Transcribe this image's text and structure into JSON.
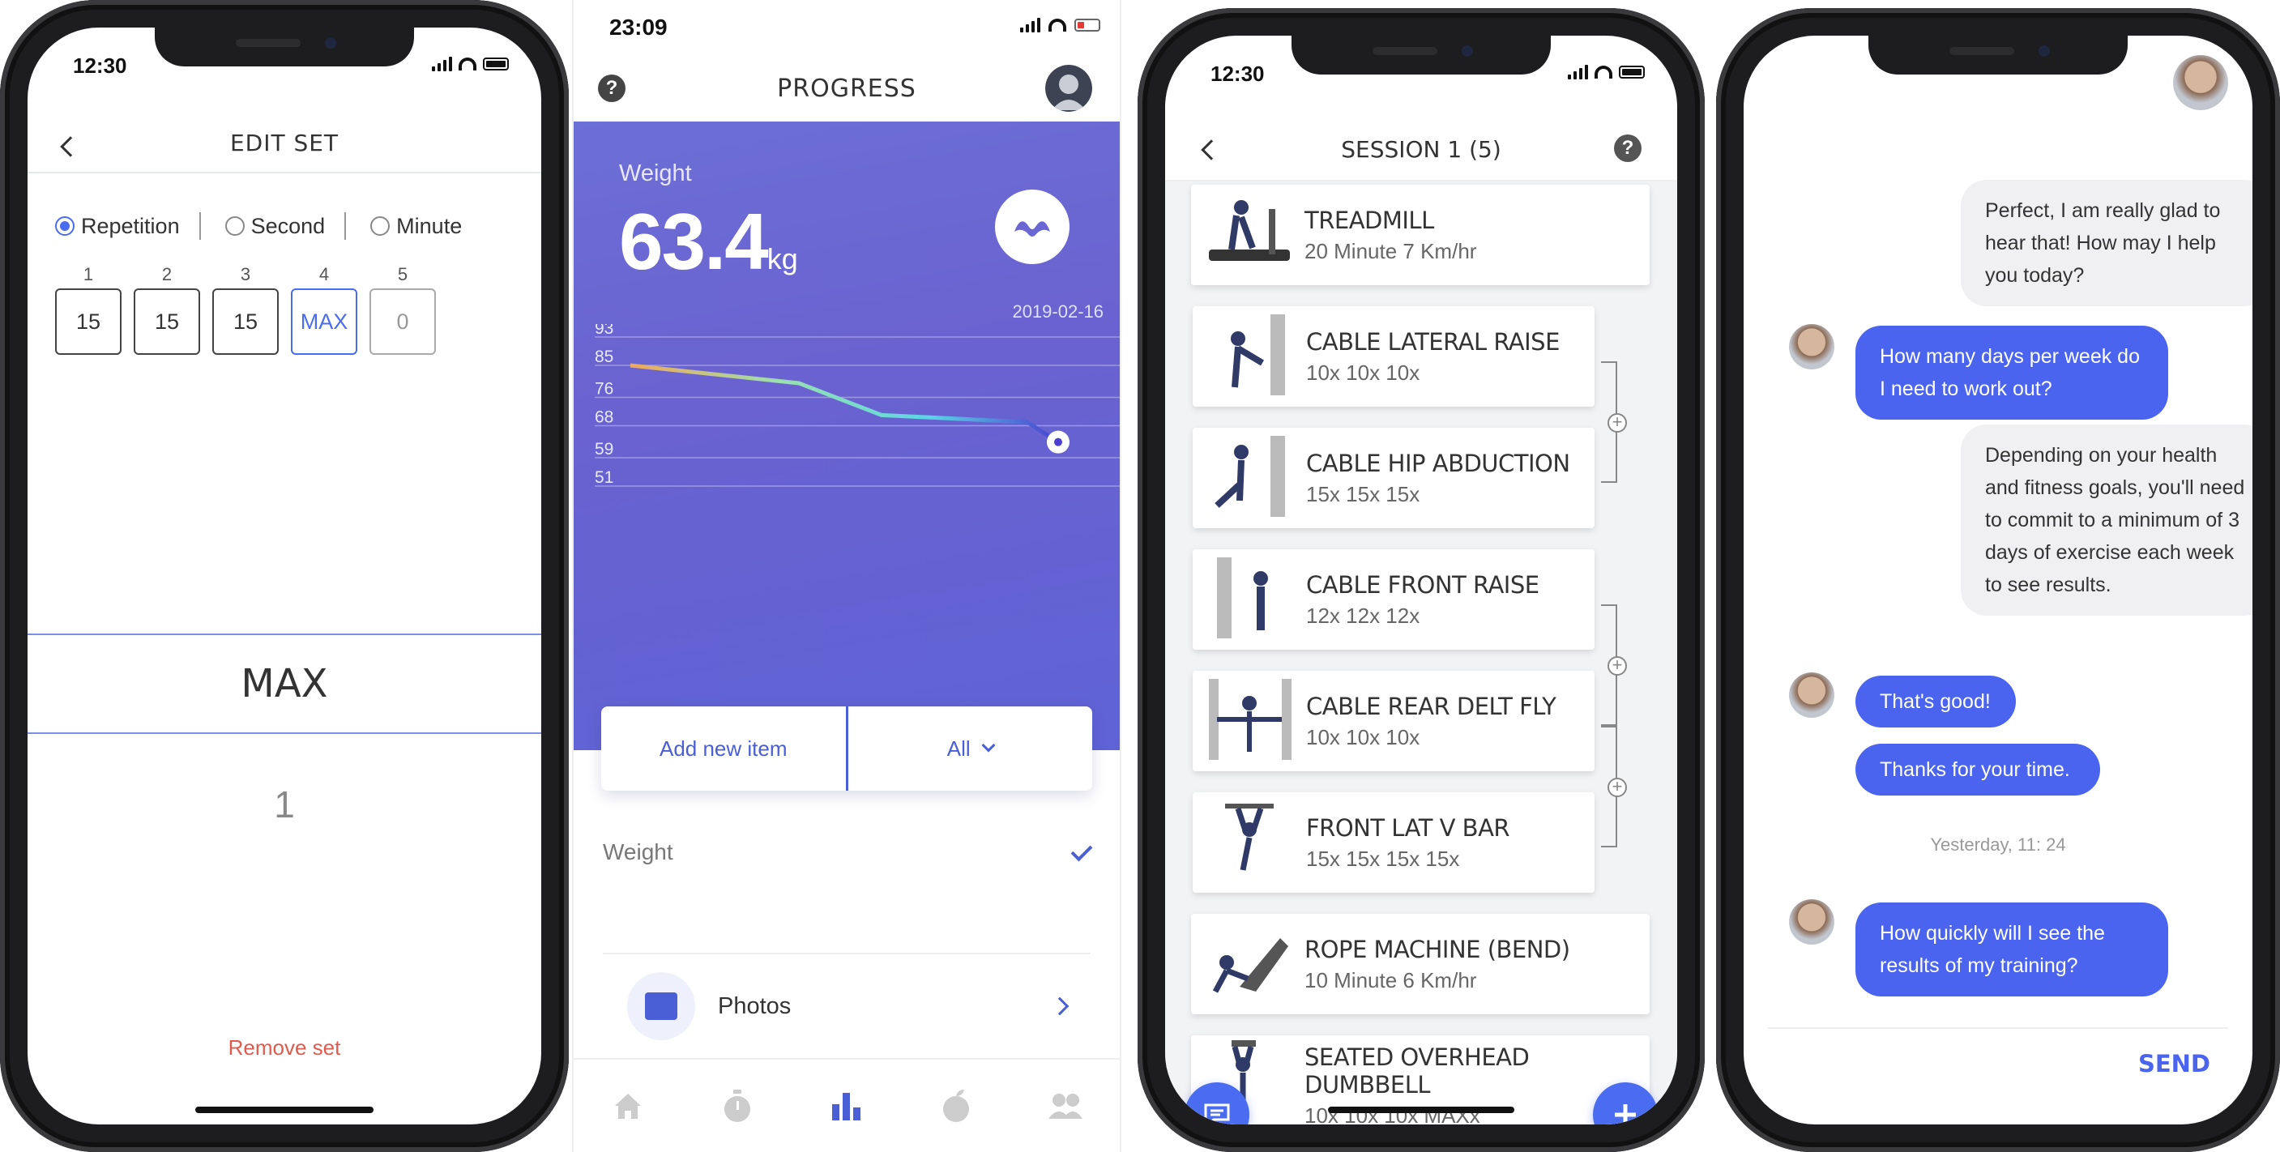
{
  "screen1": {
    "time": "12:30",
    "title": "EDIT SET",
    "modes": [
      "Repetition",
      "Second",
      "Minute"
    ],
    "selected_mode": "Repetition",
    "set_numbers": [
      "1",
      "2",
      "3",
      "4",
      "5"
    ],
    "set_values": [
      "15",
      "15",
      "15",
      "MAX",
      "0"
    ],
    "picker_selected": "MAX",
    "picker_next": "1",
    "remove_label": "Remove set"
  },
  "screen2": {
    "time": "23:09",
    "title": "PROGRESS",
    "metric_label": "Weight",
    "metric_value": "63.4",
    "metric_unit": "kg",
    "date": "2019-02-16",
    "add_label": "Add new item",
    "filter_label": "All",
    "weight_row": "Weight",
    "photos_label": "Photos",
    "tabs": [
      "home-icon",
      "timer-icon",
      "stats-icon",
      "nutrition-icon",
      "community-icon"
    ],
    "active_tab": "stats-icon"
  },
  "chart_data": {
    "type": "line",
    "yticks": [
      "93",
      "85",
      "76",
      "68",
      "59",
      "51"
    ],
    "ylim": [
      51,
      93
    ],
    "x": [
      0,
      1,
      2,
      3,
      4
    ],
    "values": [
      85,
      80,
      71,
      69,
      63.4
    ],
    "grid": true
  },
  "screen3": {
    "time": "12:30",
    "title": "SESSION 1 (5)",
    "exercises": [
      {
        "name": "TREADMILL",
        "reps": "20 Minute 7 Km/hr"
      },
      {
        "name": "CABLE LATERAL RAISE",
        "reps": "10x 10x 10x"
      },
      {
        "name": "CABLE HIP ABDUCTION",
        "reps": "15x 15x 15x"
      },
      {
        "name": "CABLE FRONT RAISE",
        "reps": "12x 12x 12x"
      },
      {
        "name": "CABLE REAR DELT FLY",
        "reps": "10x 10x 10x"
      },
      {
        "name": "FRONT LAT V BAR",
        "reps": "15x 15x 15x 15x"
      },
      {
        "name": "ROPE MACHINE (BEND)",
        "reps": "10 Minute 6 Km/hr"
      },
      {
        "name": "SEATED OVERHEAD DUMBBELL",
        "reps": "10x 10x 10x MAXx"
      }
    ]
  },
  "screen4": {
    "messages": [
      {
        "side": "in",
        "text": "Perfect, I am really glad to hear that! How may I help you today?"
      },
      {
        "side": "out",
        "text": "How many days per week do I need to work out?"
      },
      {
        "side": "in",
        "text": "Depending on your health and fitness goals, you'll need to commit to a minimum of 3 days of exercise each week to see results."
      },
      {
        "side": "out",
        "text": "That's good!"
      },
      {
        "side": "out",
        "text": "Thanks for your time."
      },
      {
        "side": "out",
        "text": "How quickly will I see the results of my training?"
      }
    ],
    "timestamp": "Yesterday, 11: 24",
    "send_label": "SEND"
  },
  "colors": {
    "accent": "#4a6cf0",
    "chat_out": "#4a64f0",
    "hero": "#6a66d3",
    "danger": "#e05a4d"
  }
}
